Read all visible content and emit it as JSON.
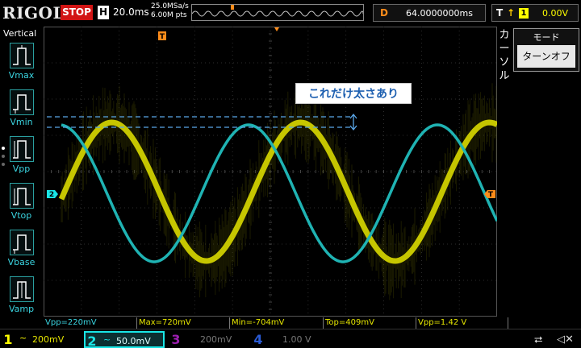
{
  "top": {
    "logo": "RIGOL",
    "run_state": "STOP",
    "timebase_label": "H",
    "timebase_value": "20.0ms",
    "sample_rate": "25.0MSa/s",
    "memory_depth": "6.00M pts",
    "delay_label": "D",
    "delay_value": "64.0000000ms",
    "trigger_label": "T",
    "trigger_source": "1",
    "trigger_level": "0.00V"
  },
  "left_panel": {
    "title": "Vertical",
    "items": [
      {
        "label": "Vmax",
        "icon": "vmax-pulse-icon"
      },
      {
        "label": "Vmin",
        "icon": "vmin-pulse-icon"
      },
      {
        "label": "Vpp",
        "icon": "vpp-pulse-icon"
      },
      {
        "label": "Vtop",
        "icon": "vtop-pulse-icon"
      },
      {
        "label": "Vbase",
        "icon": "vbase-pulse-icon"
      },
      {
        "label": "Vamp",
        "icon": "vamp-pulse-icon"
      }
    ]
  },
  "right_panel": {
    "tab_label": "カーソル",
    "menu_title": "モード",
    "menu_value": "ターンオフ"
  },
  "annotation": "これだけ太さあり",
  "markers": {
    "ch2_ground": "2",
    "trigger_level": "T",
    "trigger_position": "T"
  },
  "readouts": [
    {
      "text": "Vpp=220mV",
      "color": "#3ad4e0"
    },
    {
      "text": "Max=720mV",
      "color": "#e6e600"
    },
    {
      "text": "Min=-704mV",
      "color": "#e6e600"
    },
    {
      "text": "Top=409mV",
      "color": "#e6e600"
    },
    {
      "text": "Vpp=1.42 V",
      "color": "#e6e600"
    }
  ],
  "channels": [
    {
      "num": "1",
      "coupling": "~",
      "scale": "200mV",
      "color": "#ffff00",
      "active": true
    },
    {
      "num": "2",
      "coupling": "~",
      "scale": "50.0mV",
      "color": "#19e6e6",
      "active": true
    },
    {
      "num": "3",
      "coupling": "",
      "scale": "200mV",
      "color": "#9c1fb0",
      "active": false
    },
    {
      "num": "4",
      "coupling": "",
      "scale": "1.00 V",
      "color": "#2a5bd6",
      "active": false
    }
  ],
  "colors": {
    "ch1": "#ffff00",
    "ch2": "#19e6e6",
    "trigger": "#ff8c1a",
    "stop": "#d21414",
    "annotation_text": "#1d5fb0"
  }
}
